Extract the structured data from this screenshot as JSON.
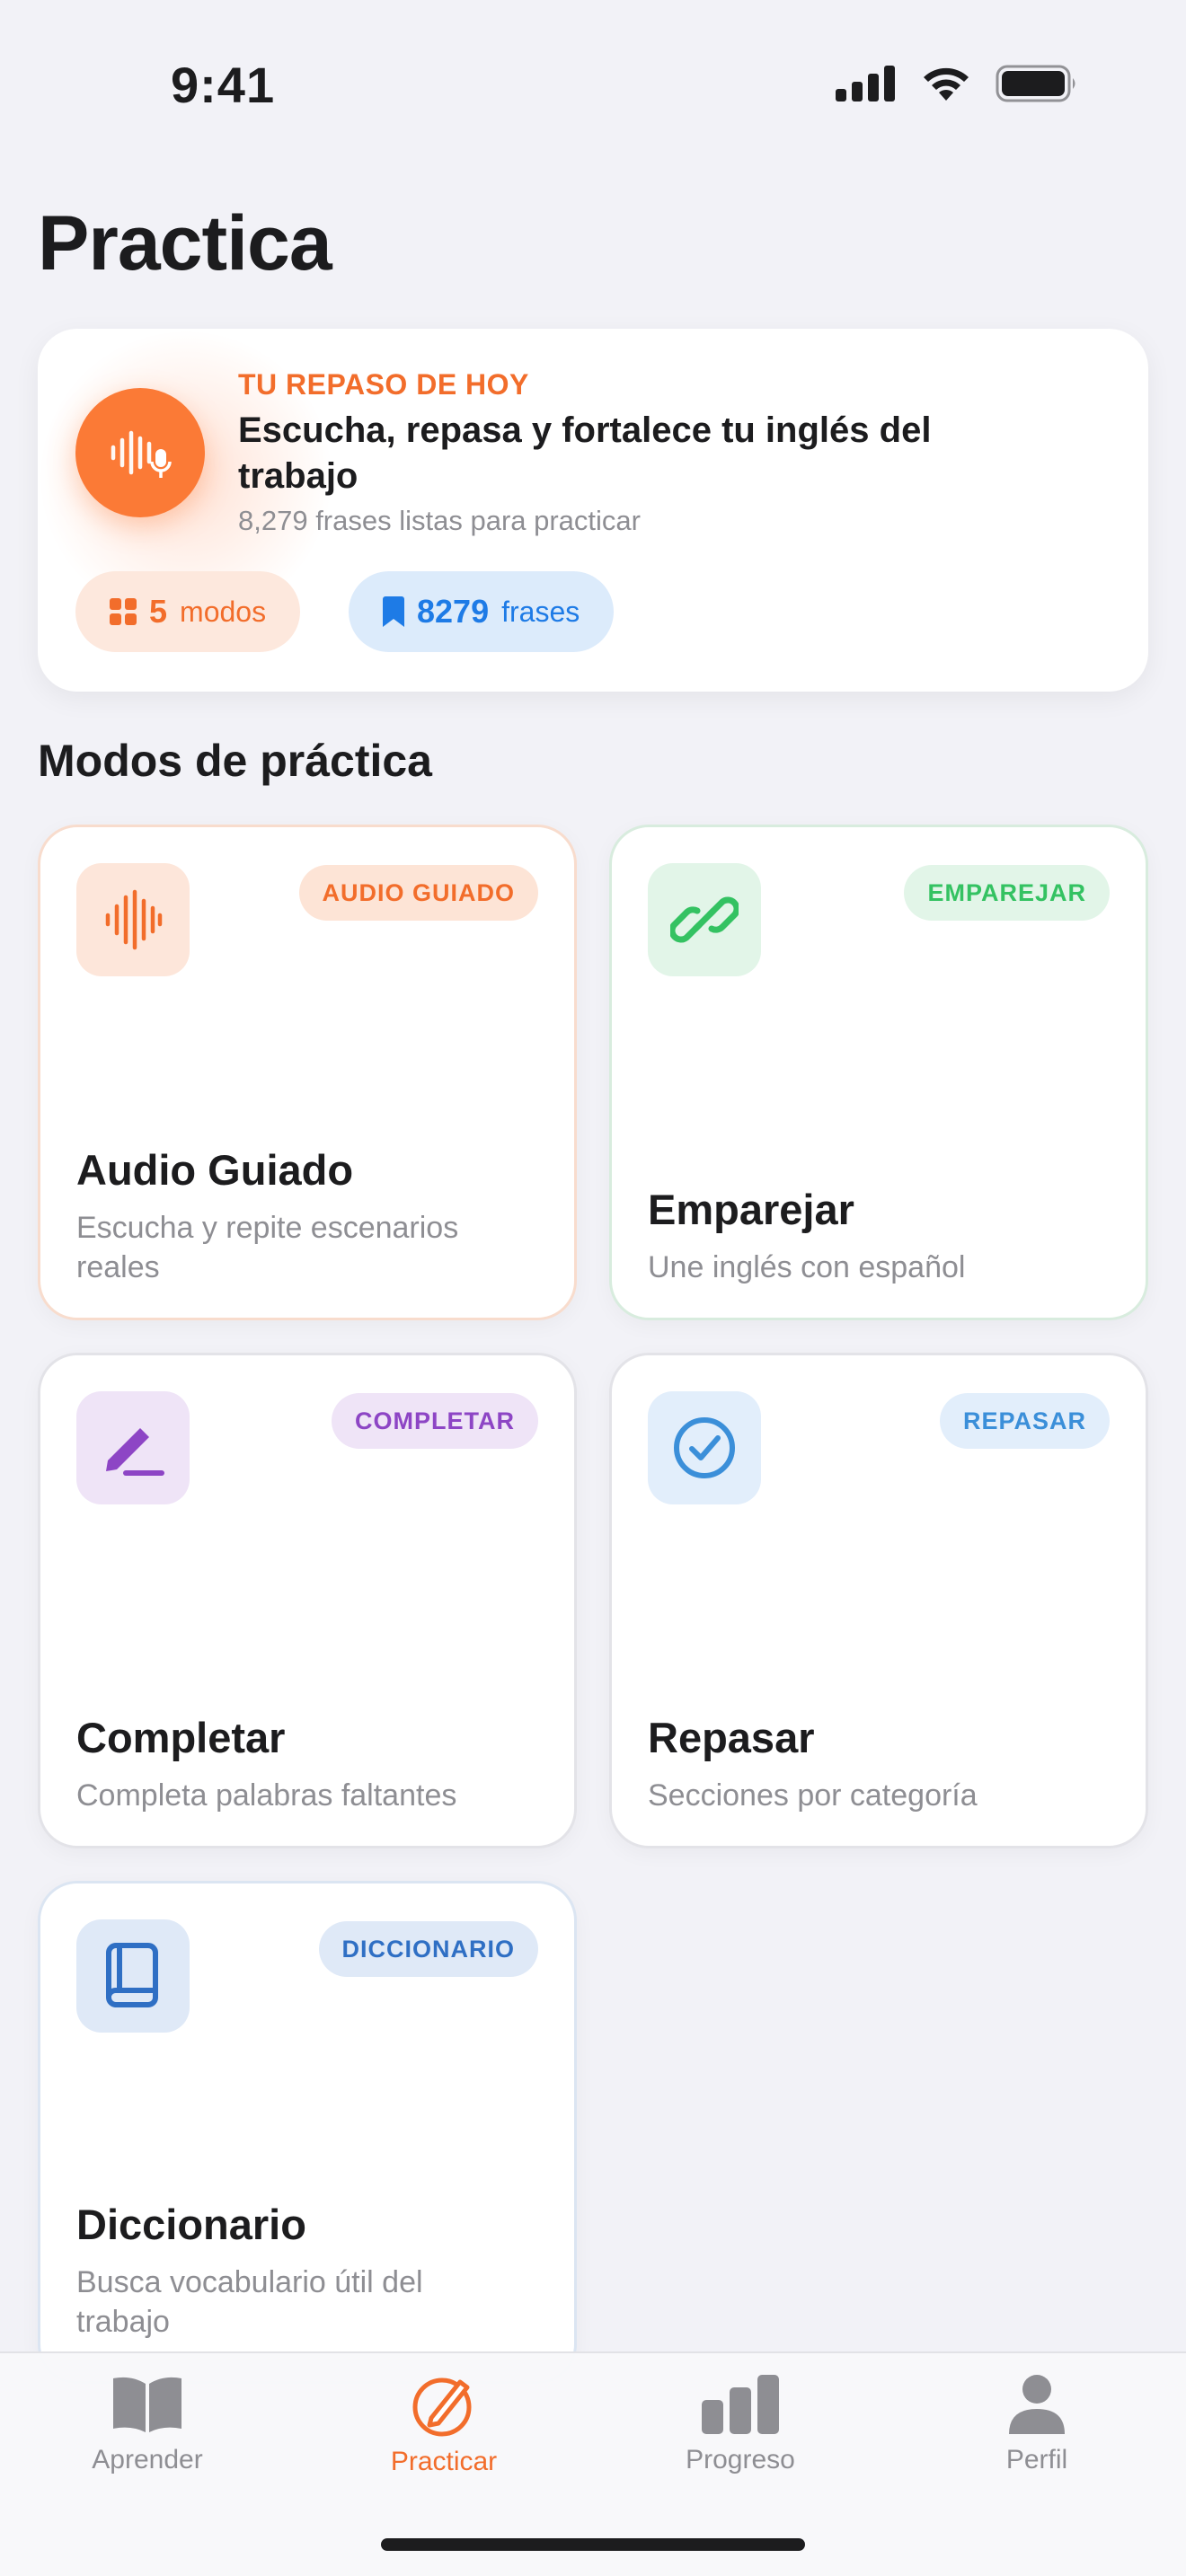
{
  "status_bar": {
    "time": "9:41"
  },
  "header": {
    "title": "Practica"
  },
  "hero": {
    "eyebrow": "TU REPASO DE HOY",
    "title": "Escucha, repasa y fortalece tu inglés del trabajo",
    "subtitle": "8,279 frases listas para practicar",
    "modes_count": "5",
    "modes_label": "modos",
    "phrases_count": "8279",
    "phrases_label": "frases",
    "icon": "waveform-mic-icon"
  },
  "section": {
    "title": "Modos de práctica"
  },
  "modes": [
    {
      "badge": "AUDIO GUIADO",
      "title": "Audio Guiado",
      "description": "Escucha y repite escenarios reales",
      "icon": "waveform-icon",
      "color": "#f26d2b"
    },
    {
      "badge": "EMPAREJAR",
      "title": "Emparejar",
      "description": "Une inglés con español",
      "icon": "link-icon",
      "color": "#34c262"
    },
    {
      "badge": "COMPLETAR",
      "title": "Completar",
      "description": "Completa palabras faltantes",
      "icon": "pencil-line-icon",
      "color": "#8d45c5"
    },
    {
      "badge": "REPASAR",
      "title": "Repasar",
      "description": "Secciones por categoría",
      "icon": "checkmark-circle-icon",
      "color": "#3b8fd9"
    },
    {
      "badge": "DICCIONARIO",
      "title": "Diccionario",
      "description": "Busca vocabulario útil del trabajo",
      "icon": "book-icon",
      "color": "#2f6fc4"
    }
  ],
  "tab_bar": {
    "items": [
      {
        "label": "Aprender",
        "icon": "book-open-icon"
      },
      {
        "label": "Practicar",
        "icon": "pencil-circle-icon",
        "active": true
      },
      {
        "label": "Progreso",
        "icon": "bar-chart-icon"
      },
      {
        "label": "Perfil",
        "icon": "person-icon"
      }
    ]
  },
  "colors": {
    "accent": "#f26d2b",
    "background": "#f2f2f7"
  }
}
